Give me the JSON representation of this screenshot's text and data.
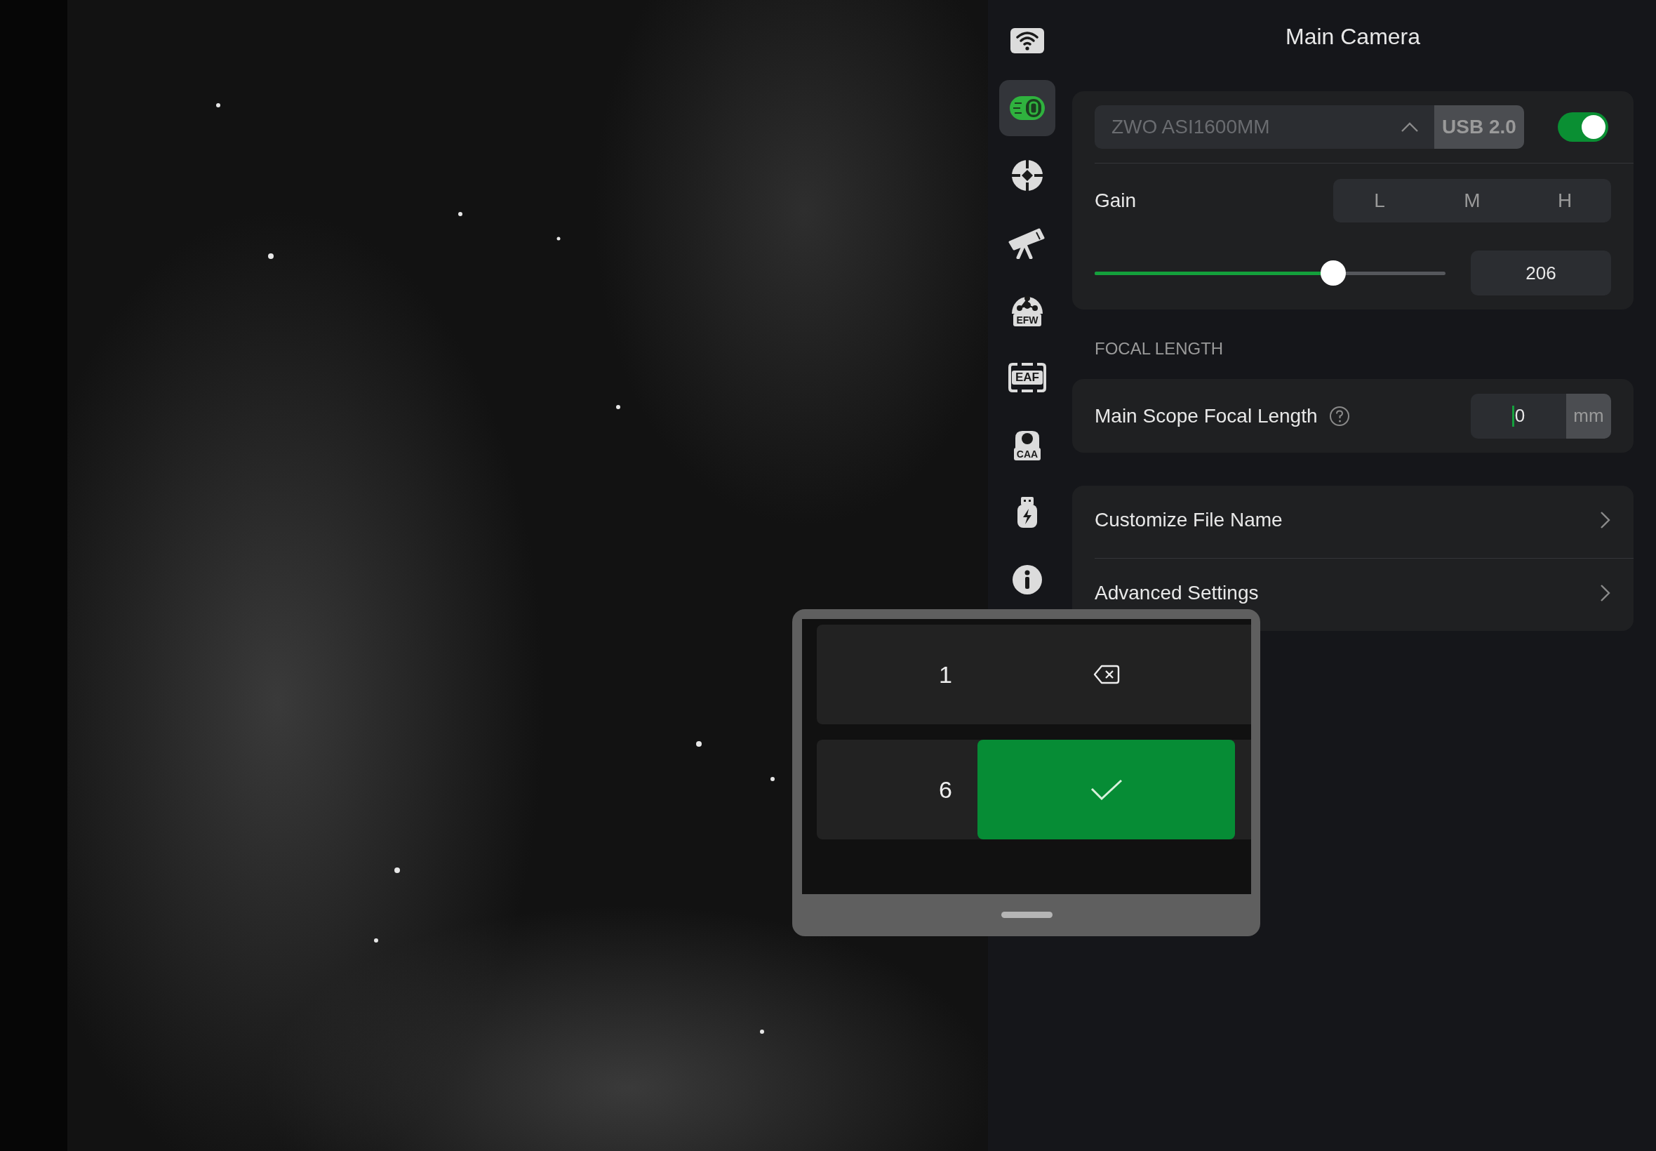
{
  "sidebar": {
    "items": [
      {
        "kind": "wifi",
        "selected": false
      },
      {
        "kind": "camera",
        "selected": true
      },
      {
        "kind": "guide",
        "selected": false
      },
      {
        "kind": "telescope",
        "selected": false
      },
      {
        "kind": "filter-wheel",
        "label": "EFW",
        "selected": false
      },
      {
        "kind": "focuser",
        "label": "EAF",
        "selected": false
      },
      {
        "kind": "accessory",
        "label": "CAA",
        "selected": false
      },
      {
        "kind": "usb-power",
        "selected": false
      },
      {
        "kind": "info",
        "selected": false
      }
    ]
  },
  "panel": {
    "title": "Main Camera",
    "camera": {
      "model": "ZWO ASI1600MM",
      "connection": "USB 2.0",
      "enabled": true
    },
    "gain": {
      "label": "Gain",
      "presets": [
        {
          "label": "L",
          "selected": false
        },
        {
          "label": "M",
          "selected": false
        },
        {
          "label": "H",
          "selected": false
        }
      ],
      "level": 0.68,
      "value": "206"
    },
    "focal_length": {
      "section": "FOCAL LENGTH",
      "label": "Main Scope Focal Length",
      "value": "0",
      "unit": "mm",
      "focused": true
    },
    "menu": [
      {
        "label": "Customize File Name"
      },
      {
        "label": "Advanced Settings"
      }
    ]
  },
  "keypad": {
    "rows": [
      [
        {
          "kind": "digit",
          "label": "1"
        },
        {
          "kind": "backspace"
        }
      ],
      [
        {
          "kind": "digit",
          "label": "6"
        },
        {
          "kind": "confirm"
        }
      ]
    ]
  }
}
